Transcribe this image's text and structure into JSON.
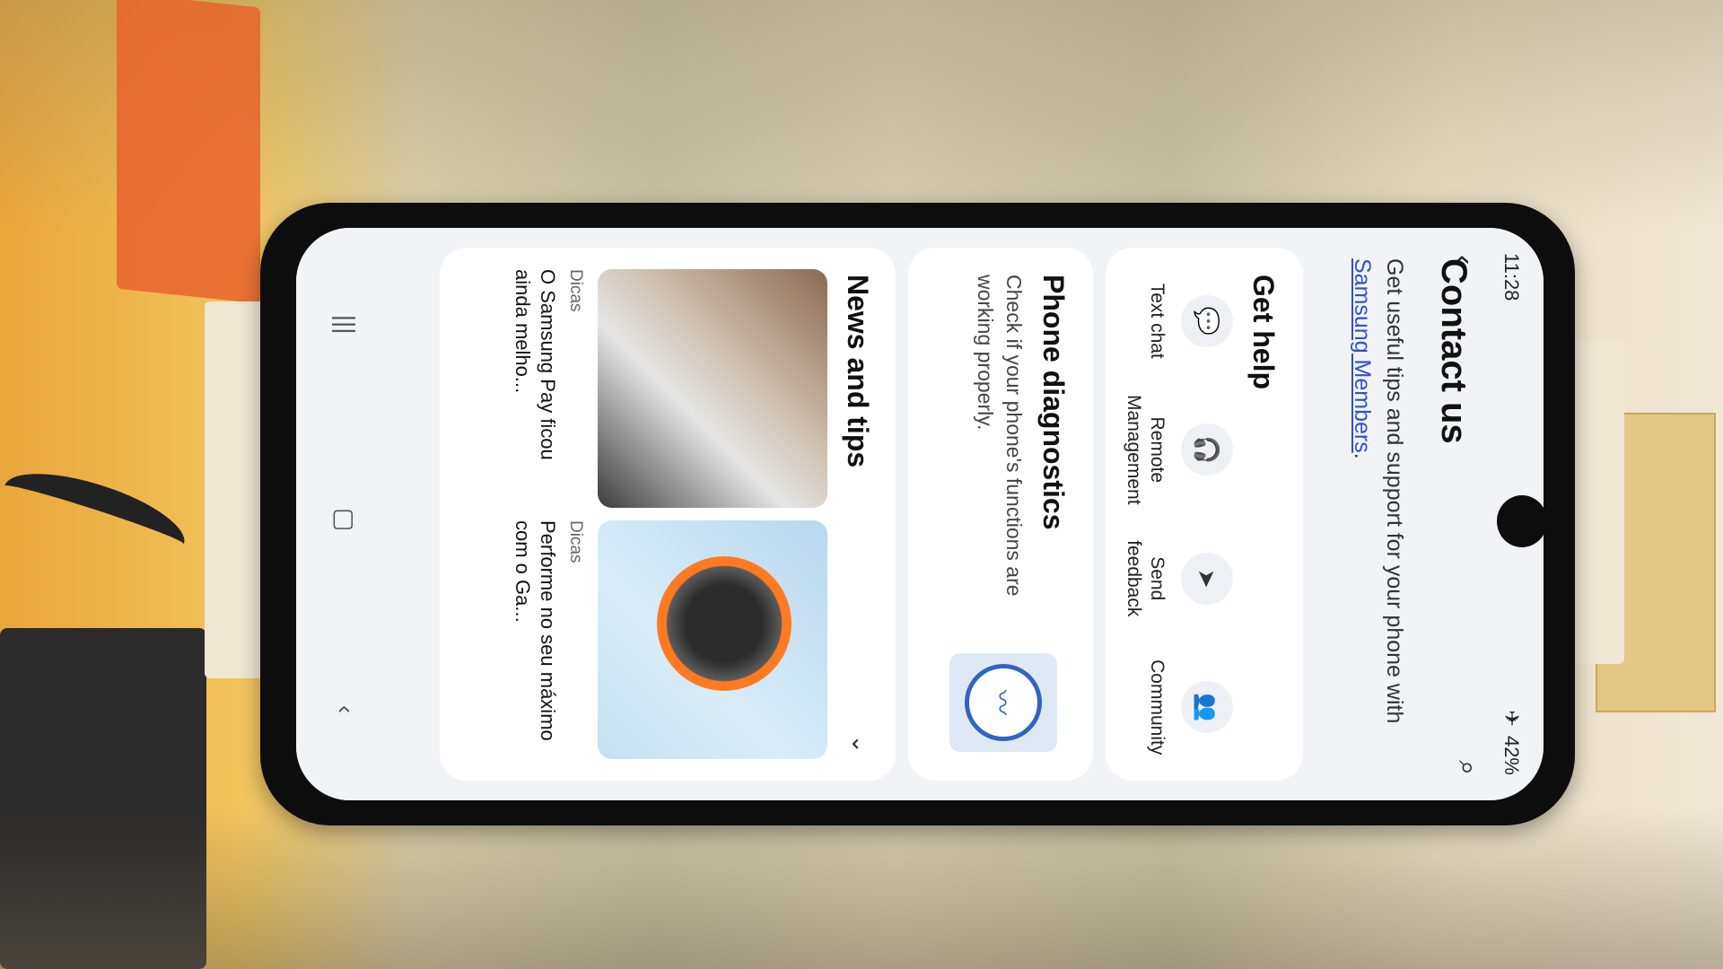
{
  "status_bar": {
    "time": "11:28",
    "battery": "42%"
  },
  "header": {
    "title": "Contact us",
    "subtitle_prefix": "Get useful tips and support for your phone with ",
    "subtitle_link": "Samsung Members",
    "subtitle_suffix": "."
  },
  "get_help": {
    "title": "Get help",
    "items": [
      {
        "label": "Text chat",
        "icon": "chat-icon"
      },
      {
        "label": "Remote Management",
        "icon": "headset-icon"
      },
      {
        "label": "Send feedback",
        "icon": "send-icon"
      },
      {
        "label": "Community",
        "icon": "community-icon"
      }
    ]
  },
  "diagnostics": {
    "title": "Phone diagnostics",
    "description": "Check if your phone's functions are working properly."
  },
  "news": {
    "title": "News and tips",
    "items": [
      {
        "tag": "Dicas",
        "headline": "O Samsung Pay ficou ainda melho..."
      },
      {
        "tag": "Dicas",
        "headline": "Performe no seu máximo com o Ga..."
      }
    ]
  }
}
